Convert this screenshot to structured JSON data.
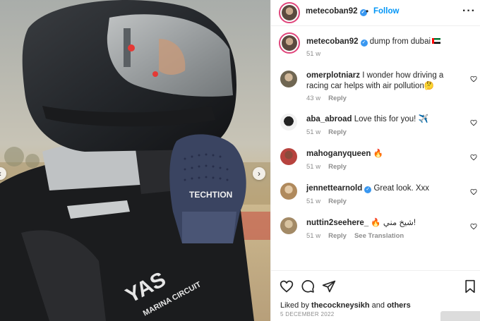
{
  "header": {
    "username": "metecoban92",
    "verified": true,
    "follow_label": "Follow",
    "dot": "•",
    "more_icon": "more-horizontal-icon",
    "more_glyph": "···"
  },
  "caption": {
    "username": "metecoban92",
    "verified": true,
    "text": "dump from dubai",
    "flag_icon": "uae-flag-icon",
    "time": "51 w"
  },
  "comments": [
    {
      "username": "omerplotniarz",
      "verified": false,
      "text": "I wonder how driving a racing car helps with air pollution🤔",
      "time": "43 w",
      "reply": "Reply",
      "extra": ""
    },
    {
      "username": "aba_abroad",
      "verified": false,
      "text": "Love this for you! ✈️",
      "time": "51 w",
      "reply": "Reply",
      "extra": ""
    },
    {
      "username": "mahoganyqueen",
      "verified": false,
      "text": "🔥",
      "time": "51 w",
      "reply": "Reply",
      "extra": ""
    },
    {
      "username": "jennettearnold",
      "verified": true,
      "text": "Great look. Xxx",
      "time": "51 w",
      "reply": "Reply",
      "extra": ""
    },
    {
      "username": "nuttin2seehere_",
      "verified": false,
      "text": "🔥 شيخ مني!",
      "time": "51 w",
      "reply": "Reply",
      "extra": "See Translation"
    }
  ],
  "actions": {
    "like_icon": "heart-icon",
    "comment_icon": "comment-icon",
    "share_icon": "share-icon",
    "save_icon": "bookmark-icon"
  },
  "likes": {
    "prefix": "Liked by",
    "user": "thecockneysikh",
    "conj": "and",
    "others": "others"
  },
  "date": "5 DECEMBER 2022",
  "photo": {
    "glove_brand": "TECHTION",
    "suit_text": "YAS MARINA CIRCUIT",
    "nav_prev": "‹",
    "nav_next": "›"
  },
  "colors": {
    "accent": "#0095f6",
    "verified": "#3897f0",
    "story_ring": "#e0457b",
    "muted": "#8e8e8e",
    "text": "#262626"
  }
}
